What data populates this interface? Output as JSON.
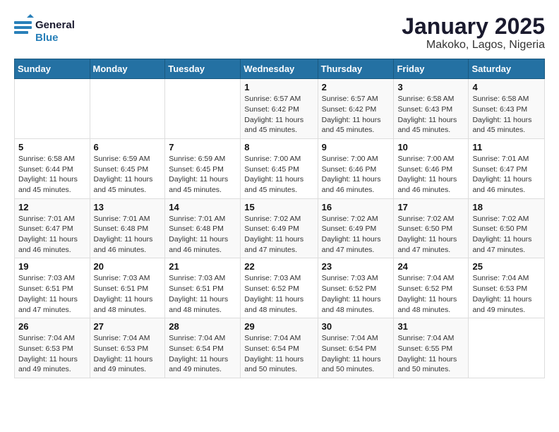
{
  "header": {
    "logo_line1": "General",
    "logo_line2": "Blue",
    "month": "January 2025",
    "location": "Makoko, Lagos, Nigeria"
  },
  "weekdays": [
    "Sunday",
    "Monday",
    "Tuesday",
    "Wednesday",
    "Thursday",
    "Friday",
    "Saturday"
  ],
  "weeks": [
    [
      {
        "day": "",
        "info": ""
      },
      {
        "day": "",
        "info": ""
      },
      {
        "day": "",
        "info": ""
      },
      {
        "day": "1",
        "info": "Sunrise: 6:57 AM\nSunset: 6:42 PM\nDaylight: 11 hours\nand 45 minutes."
      },
      {
        "day": "2",
        "info": "Sunrise: 6:57 AM\nSunset: 6:42 PM\nDaylight: 11 hours\nand 45 minutes."
      },
      {
        "day": "3",
        "info": "Sunrise: 6:58 AM\nSunset: 6:43 PM\nDaylight: 11 hours\nand 45 minutes."
      },
      {
        "day": "4",
        "info": "Sunrise: 6:58 AM\nSunset: 6:43 PM\nDaylight: 11 hours\nand 45 minutes."
      }
    ],
    [
      {
        "day": "5",
        "info": "Sunrise: 6:58 AM\nSunset: 6:44 PM\nDaylight: 11 hours\nand 45 minutes."
      },
      {
        "day": "6",
        "info": "Sunrise: 6:59 AM\nSunset: 6:45 PM\nDaylight: 11 hours\nand 45 minutes."
      },
      {
        "day": "7",
        "info": "Sunrise: 6:59 AM\nSunset: 6:45 PM\nDaylight: 11 hours\nand 45 minutes."
      },
      {
        "day": "8",
        "info": "Sunrise: 7:00 AM\nSunset: 6:45 PM\nDaylight: 11 hours\nand 45 minutes."
      },
      {
        "day": "9",
        "info": "Sunrise: 7:00 AM\nSunset: 6:46 PM\nDaylight: 11 hours\nand 46 minutes."
      },
      {
        "day": "10",
        "info": "Sunrise: 7:00 AM\nSunset: 6:46 PM\nDaylight: 11 hours\nand 46 minutes."
      },
      {
        "day": "11",
        "info": "Sunrise: 7:01 AM\nSunset: 6:47 PM\nDaylight: 11 hours\nand 46 minutes."
      }
    ],
    [
      {
        "day": "12",
        "info": "Sunrise: 7:01 AM\nSunset: 6:47 PM\nDaylight: 11 hours\nand 46 minutes."
      },
      {
        "day": "13",
        "info": "Sunrise: 7:01 AM\nSunset: 6:48 PM\nDaylight: 11 hours\nand 46 minutes."
      },
      {
        "day": "14",
        "info": "Sunrise: 7:01 AM\nSunset: 6:48 PM\nDaylight: 11 hours\nand 46 minutes."
      },
      {
        "day": "15",
        "info": "Sunrise: 7:02 AM\nSunset: 6:49 PM\nDaylight: 11 hours\nand 47 minutes."
      },
      {
        "day": "16",
        "info": "Sunrise: 7:02 AM\nSunset: 6:49 PM\nDaylight: 11 hours\nand 47 minutes."
      },
      {
        "day": "17",
        "info": "Sunrise: 7:02 AM\nSunset: 6:50 PM\nDaylight: 11 hours\nand 47 minutes."
      },
      {
        "day": "18",
        "info": "Sunrise: 7:02 AM\nSunset: 6:50 PM\nDaylight: 11 hours\nand 47 minutes."
      }
    ],
    [
      {
        "day": "19",
        "info": "Sunrise: 7:03 AM\nSunset: 6:51 PM\nDaylight: 11 hours\nand 47 minutes."
      },
      {
        "day": "20",
        "info": "Sunrise: 7:03 AM\nSunset: 6:51 PM\nDaylight: 11 hours\nand 48 minutes."
      },
      {
        "day": "21",
        "info": "Sunrise: 7:03 AM\nSunset: 6:51 PM\nDaylight: 11 hours\nand 48 minutes."
      },
      {
        "day": "22",
        "info": "Sunrise: 7:03 AM\nSunset: 6:52 PM\nDaylight: 11 hours\nand 48 minutes."
      },
      {
        "day": "23",
        "info": "Sunrise: 7:03 AM\nSunset: 6:52 PM\nDaylight: 11 hours\nand 48 minutes."
      },
      {
        "day": "24",
        "info": "Sunrise: 7:04 AM\nSunset: 6:52 PM\nDaylight: 11 hours\nand 48 minutes."
      },
      {
        "day": "25",
        "info": "Sunrise: 7:04 AM\nSunset: 6:53 PM\nDaylight: 11 hours\nand 49 minutes."
      }
    ],
    [
      {
        "day": "26",
        "info": "Sunrise: 7:04 AM\nSunset: 6:53 PM\nDaylight: 11 hours\nand 49 minutes."
      },
      {
        "day": "27",
        "info": "Sunrise: 7:04 AM\nSunset: 6:53 PM\nDaylight: 11 hours\nand 49 minutes."
      },
      {
        "day": "28",
        "info": "Sunrise: 7:04 AM\nSunset: 6:54 PM\nDaylight: 11 hours\nand 49 minutes."
      },
      {
        "day": "29",
        "info": "Sunrise: 7:04 AM\nSunset: 6:54 PM\nDaylight: 11 hours\nand 50 minutes."
      },
      {
        "day": "30",
        "info": "Sunrise: 7:04 AM\nSunset: 6:54 PM\nDaylight: 11 hours\nand 50 minutes."
      },
      {
        "day": "31",
        "info": "Sunrise: 7:04 AM\nSunset: 6:55 PM\nDaylight: 11 hours\nand 50 minutes."
      },
      {
        "day": "",
        "info": ""
      }
    ]
  ]
}
